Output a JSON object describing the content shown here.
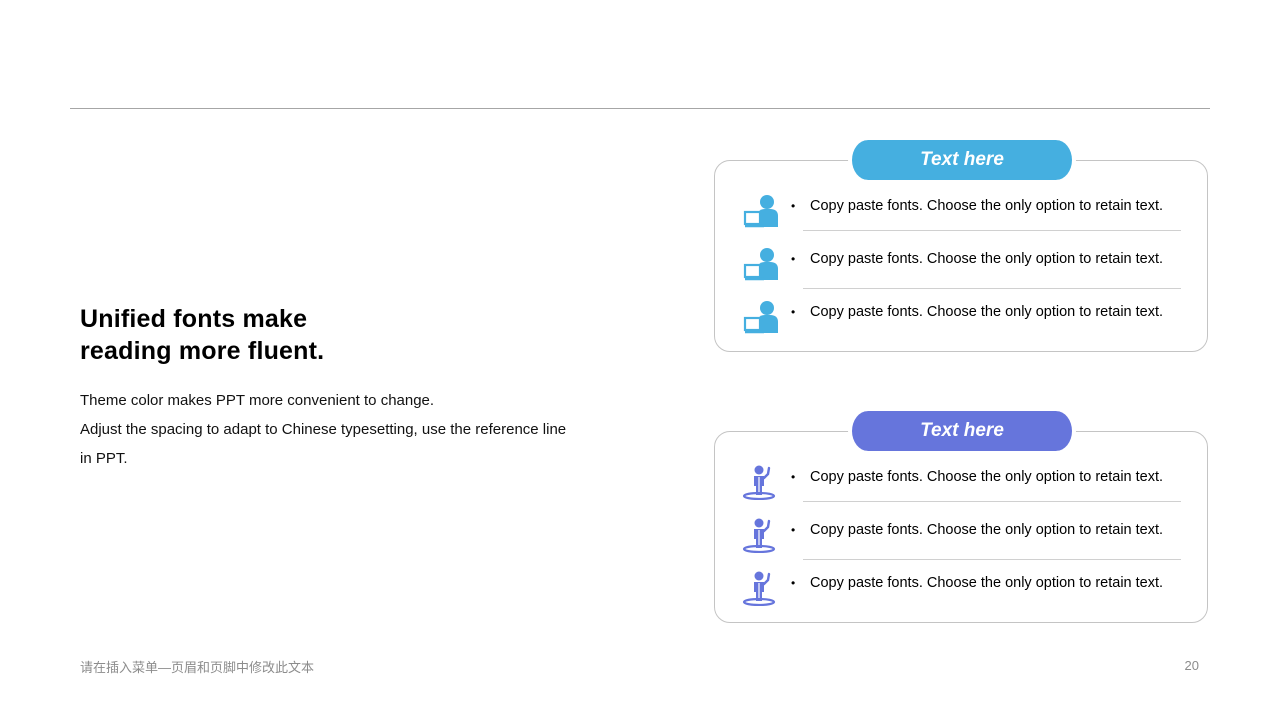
{
  "slide": {
    "headline_lines": [
      "Unified fonts make",
      "reading more fluent."
    ],
    "body_lines": [
      "Theme color makes PPT more convenient to change.",
      "Adjust the spacing to adapt to Chinese typesetting, use the reference line",
      "in PPT."
    ]
  },
  "cards": [
    {
      "title": "Text here",
      "accent": "#45afe0",
      "icon": "person-at-laptop-icon",
      "items": [
        {
          "bullet": "•",
          "text": "Copy paste fonts. Choose the only option to retain text."
        },
        {
          "bullet": "•",
          "text": "Copy paste fonts. Choose the only option to retain text."
        },
        {
          "bullet": "•",
          "text": "Copy paste fonts. Choose the only option to retain text."
        }
      ]
    },
    {
      "title": "Text here",
      "accent": "#6675dc",
      "icon": "person-on-platform-icon",
      "items": [
        {
          "bullet": "•",
          "text": "Copy paste fonts. Choose the only option to retain text."
        },
        {
          "bullet": "•",
          "text": "Copy paste fonts. Choose the only option to retain text."
        },
        {
          "bullet": "•",
          "text": "Copy paste fonts. Choose the only option to retain text."
        }
      ]
    }
  ],
  "footer": {
    "note": "请在插入菜单—页眉和页脚中修改此文本",
    "page_number": "20"
  }
}
